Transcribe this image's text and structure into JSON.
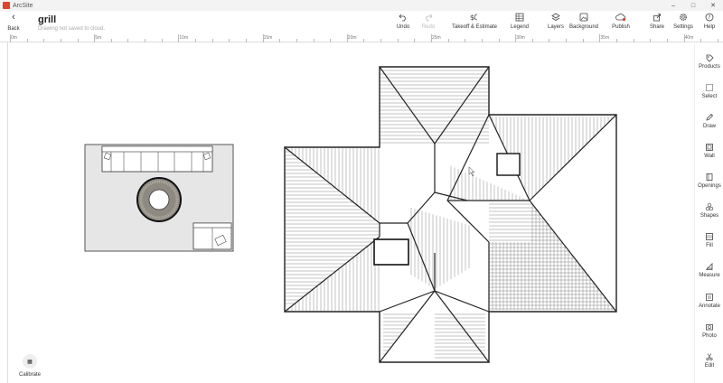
{
  "window": {
    "app_name": "ArcSite"
  },
  "header": {
    "back_label": "Back",
    "title": "grill",
    "status": "Drawing not saved to cloud."
  },
  "toolbar": [
    {
      "name": "undo-button",
      "icon": "undo-icon",
      "label": "Undo",
      "enabled": true
    },
    {
      "name": "redo-button",
      "icon": "redo-icon",
      "label": "Redo",
      "enabled": false
    },
    {
      "name": "takeoff-estimate-button",
      "icon": "takeoff-icon",
      "label": "Takeoff & Estimate",
      "enabled": true
    },
    {
      "name": "legend-button",
      "icon": "grid-icon",
      "label": "Legend",
      "enabled": true
    },
    {
      "name": "layers-button",
      "icon": "layers-icon",
      "label": "Layers",
      "enabled": true
    },
    {
      "name": "background-button",
      "icon": "image-icon",
      "label": "Background",
      "enabled": true
    },
    {
      "name": "publish-button",
      "icon": "cloud-upload-icon",
      "label": "Publish",
      "enabled": true
    },
    {
      "name": "share-button",
      "icon": "share-icon",
      "label": "Share",
      "enabled": true
    },
    {
      "name": "settings-button",
      "icon": "gear-icon",
      "label": "Settings",
      "enabled": true
    },
    {
      "name": "help-button",
      "icon": "help-icon",
      "label": "Help",
      "enabled": true
    }
  ],
  "ruler": {
    "top_labels": [
      "0m",
      "5m",
      "10m",
      "15m",
      "20m",
      "25m",
      "30m",
      "35m",
      "40m"
    ]
  },
  "sidebar": [
    {
      "name": "products-tool",
      "icon": "tag-icon",
      "label": "Products"
    },
    {
      "name": "select-tool",
      "icon": "select-icon",
      "label": "Select"
    },
    {
      "name": "draw-tool",
      "icon": "pen-icon",
      "label": "Draw"
    },
    {
      "name": "wall-tool",
      "icon": "wall-icon",
      "label": "Wall"
    },
    {
      "name": "openings-tool",
      "icon": "door-icon",
      "label": "Openings"
    },
    {
      "name": "shapes-tool",
      "icon": "shapes-icon",
      "label": "Shapes"
    },
    {
      "name": "fill-tool",
      "icon": "fill-icon",
      "label": "Fill"
    },
    {
      "name": "measure-tool",
      "icon": "ruler-icon",
      "label": "Measure"
    },
    {
      "name": "annotate-tool",
      "icon": "annotate-icon",
      "label": "Annotate"
    },
    {
      "name": "photo-tool",
      "icon": "camera-icon",
      "label": "Photo"
    },
    {
      "name": "edit-tool",
      "icon": "scissors-icon",
      "label": "Edit"
    }
  ],
  "calibrate": {
    "label": "Calibrate"
  },
  "colors": {
    "canvas_bg": "#ffffff",
    "rug_fill": "#e6e6e6",
    "line": "#222222",
    "accent": "#e0442a"
  }
}
